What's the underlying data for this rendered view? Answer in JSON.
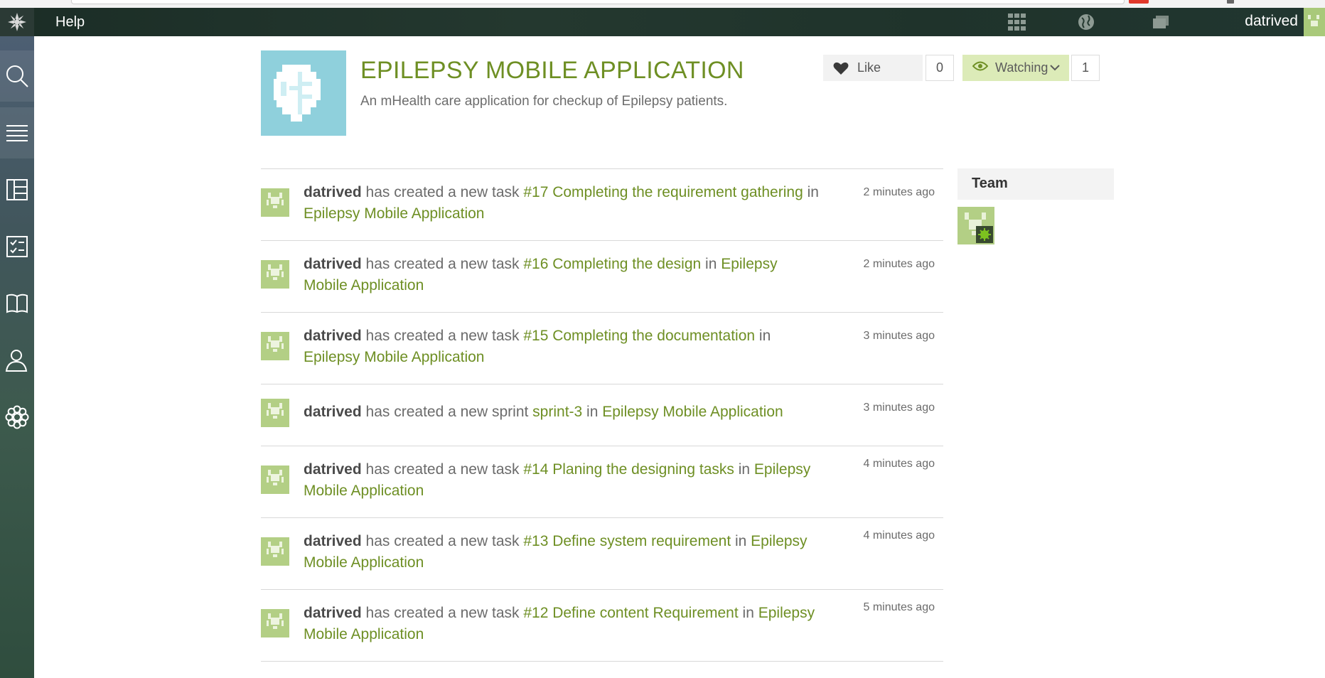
{
  "topbar": {
    "help_label": "Help",
    "username": "datrived",
    "icons": [
      "star-logo-icon",
      "apps-grid-icon",
      "globe-icon",
      "folders-icon"
    ]
  },
  "sidebar": {
    "items": [
      {
        "icon": "search-icon"
      },
      {
        "icon": "menu-icon"
      },
      {
        "icon": "kanban-icon"
      },
      {
        "icon": "tasks-icon"
      },
      {
        "icon": "wiki-book-icon"
      },
      {
        "icon": "team-icon"
      },
      {
        "icon": "settings-icon"
      }
    ]
  },
  "project": {
    "title": "EPILEPSY MOBILE APPLICATION",
    "description": "An mHealth care application for checkup of Epilepsy patients.",
    "like_label": "Like",
    "like_count": "0",
    "watch_label": "Watching",
    "watch_count": "1"
  },
  "timeline": [
    {
      "user": "datrived",
      "action": " has created a new task ",
      "item": "#17 Completing the requirement gathering",
      "in": " in ",
      "project": "Epilepsy Mobile Application",
      "time": "2 minutes ago"
    },
    {
      "user": "datrived",
      "action": " has created a new task ",
      "item": "#16 Completing the design",
      "in": " in ",
      "project": "Epilepsy Mobile Application",
      "time": "2 minutes ago"
    },
    {
      "user": "datrived",
      "action": " has created a new task ",
      "item": "#15 Completing the documentation",
      "in": " in ",
      "project": "Epilepsy Mobile Application",
      "time": "3 minutes ago"
    },
    {
      "user": "datrived",
      "action": " has created a new sprint ",
      "item": "sprint-3",
      "in": " in ",
      "project": "Epilepsy Mobile Application",
      "time": "3 minutes ago"
    },
    {
      "user": "datrived",
      "action": " has created a new task ",
      "item": "#14 Planing the designing tasks",
      "in": " in ",
      "project": "Epilepsy Mobile Application",
      "time": "4 minutes ago"
    },
    {
      "user": "datrived",
      "action": " has created a new task ",
      "item": "#13 Define system requirement",
      "in": " in ",
      "project": "Epilepsy Mobile Application",
      "time": "4 minutes ago"
    },
    {
      "user": "datrived",
      "action": " has created a new task ",
      "item": "#12 Define content Requirement",
      "in": " in ",
      "project": "Epilepsy Mobile Application",
      "time": "5 minutes ago"
    }
  ],
  "team": {
    "heading": "Team"
  }
}
